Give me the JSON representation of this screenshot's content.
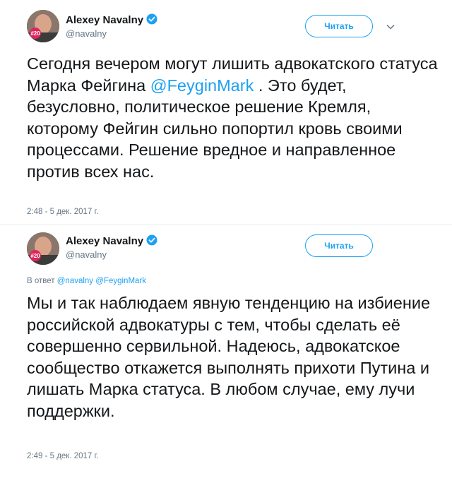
{
  "tweets": [
    {
      "author_name": "Alexey Navalny",
      "author_handle": "@navalny",
      "follow_label": "Читать",
      "avatar_badge": "#20",
      "text_parts": [
        "Сегодня вечером могут лишить адвокатского статуса Марка Фейгина ",
        "@FeyginMark",
        " . Это будет, безусловно, политическое решение Кремля, которому Фейгин сильно попортил кровь своими процессами. Решение вредное и направленное против всех нас."
      ],
      "timestamp": "2:48 - 5 дек. 2017 г."
    },
    {
      "author_name": "Alexey Navalny",
      "author_handle": "@navalny",
      "follow_label": "Читать",
      "avatar_badge": "#20",
      "reply_prefix": "В ответ",
      "reply_mentions": [
        "@navalny",
        "@FeyginMark"
      ],
      "text": "Мы и так наблюдаем явную тенденцию на избиение российской адвокатуры с тем, чтобы сделать её совершенно сервильной. Надеюсь, адвокатское сообщество откажется выполнять прихоти Путина и лишать Марка статуса. В любом случае, ему лучи поддержки.",
      "timestamp": "2:49 - 5 дек. 2017 г."
    }
  ],
  "colors": {
    "accent": "#1da1f2",
    "secondary_text": "#657786",
    "badge": "#e0245e"
  },
  "icons": {
    "verified": "verified-badge-icon",
    "caret": "chevron-down-icon"
  }
}
